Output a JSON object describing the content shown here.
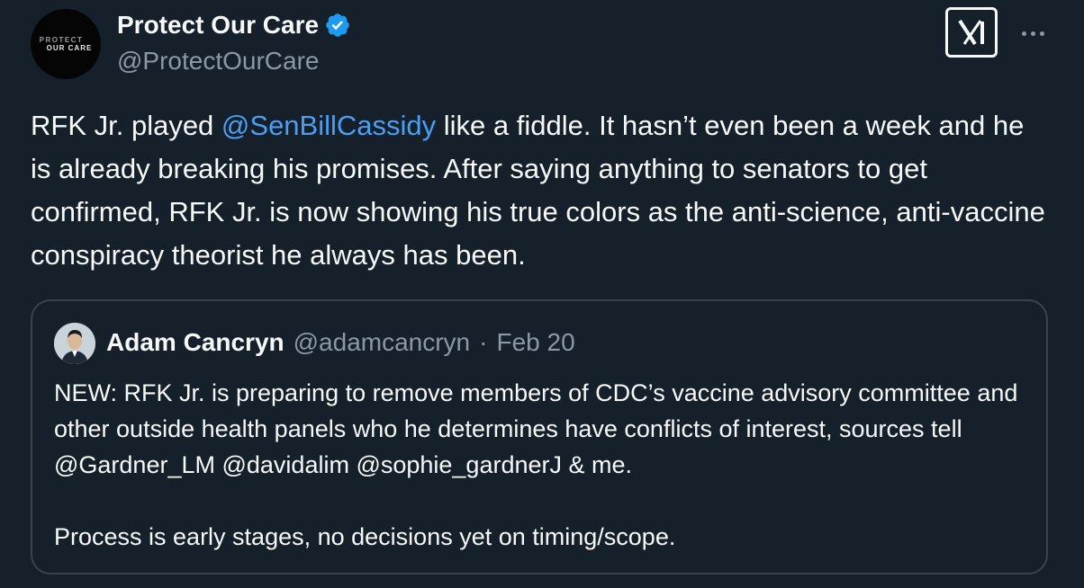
{
  "author": {
    "display_name": "Protect Our Care",
    "handle": "@ProtectOurCare",
    "avatar_line1": "PROTECT",
    "avatar_line2": "OUR CARE",
    "verified": true
  },
  "tweet": {
    "text_before": "RFK Jr. played ",
    "mention": "@SenBillCassidy",
    "text_after": " like a fiddle. It hasn’t even been a week and he is already breaking his promises. After saying anything to senators to get confirmed, RFK Jr. is now showing his true colors as the anti-science, anti-vaccine conspiracy theorist he always has been."
  },
  "quote": {
    "display_name": "Adam Cancryn",
    "handle": "@adamcancryn",
    "separator": "·",
    "date": "Feb 20",
    "paragraph1": "NEW: RFK Jr. is preparing to remove members of CDC’s vaccine advisory committee and other outside health panels who he determines have conflicts of interest, sources tell @Gardner_LM @davidalim @sophie_gardnerJ & me.",
    "paragraph2": "Process is early stages, no decisions yet on timing/scope."
  },
  "icons": {
    "verified": "verified-badge-icon",
    "x_logo": "x-logo-icon",
    "more": "more-options-icon"
  },
  "colors": {
    "background": "#15202b",
    "text": "#f7f9f9",
    "secondary": "#8b98a5",
    "link": "#4a9ff5",
    "verified": "#1d9bf0",
    "border": "#38444d"
  }
}
